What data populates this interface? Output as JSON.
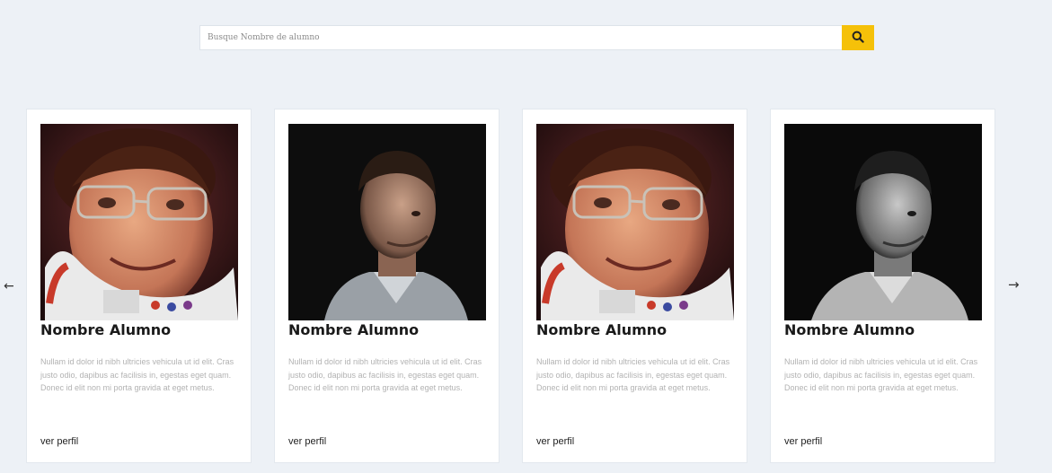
{
  "search": {
    "placeholder": "Busque Nombre de alumno",
    "button_icon": "search-icon",
    "button_color": "#f5c109"
  },
  "carousel": {
    "prev_arrow": "←",
    "next_arrow": "→"
  },
  "cards": [
    {
      "name": "Nombre Alumno",
      "description": "Nullam id dolor id nibh ultricies vehicula ut id elit. Cras justo odio, dapibus ac facilisis in, egestas eget quam. Donec id elit non mi porta gravida at eget metus.",
      "link": "ver perfil",
      "photo": "astronaut-portrait"
    },
    {
      "name": "Nombre Alumno",
      "description": "Nullam id dolor id nibh ultricies vehicula ut id elit. Cras justo odio, dapibus ac facilisis in, egestas eget quam. Donec id elit non mi porta gravida at eget metus.",
      "link": "ver perfil",
      "photo": "man-portrait-dark"
    },
    {
      "name": "Nombre Alumno",
      "description": "Nullam id dolor id nibh ultricies vehicula ut id elit. Cras justo odio, dapibus ac facilisis in, egestas eget quam. Donec id elit non mi porta gravida at eget metus.",
      "link": "ver perfil",
      "photo": "astronaut-portrait"
    },
    {
      "name": "Nombre Alumno",
      "description": "Nullam id dolor id nibh ultricies vehicula ut id elit. Cras justo odio, dapibus ac facilisis in, egestas eget quam. Donec id elit non mi porta gravida at eget metus.",
      "link": "ver perfil",
      "photo": "man-portrait-bw"
    }
  ]
}
